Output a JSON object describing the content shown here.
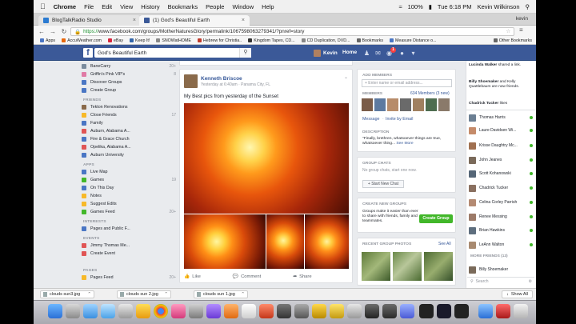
{
  "menubar": {
    "items": [
      "Chrome",
      "File",
      "Edit",
      "View",
      "History",
      "Bookmarks",
      "People",
      "Window",
      "Help"
    ],
    "battery": "100%",
    "clock": "Tue 6:18 PM",
    "user": "Kevin Wilkinson"
  },
  "tabs": [
    {
      "label": "BlogTalkRadio Studio",
      "active": false
    },
    {
      "label": "(1) God's Beautiful Earth",
      "active": true
    },
    {
      "label": "kevin",
      "active": false
    }
  ],
  "url": {
    "scheme": "https://",
    "rest": "www.facebook.com/groups/MotherNaturesGlory/permalink/1067598063279341/?pnref=story"
  },
  "bookmarks": [
    "Apps",
    "AccuWeather.com",
    "eBay",
    "Keep It!",
    "SNOWatHOME",
    "Hebrew for Christia..",
    "Kingdom Tapes, CD...",
    "CD Duplication, DVD...",
    "Bookmarks",
    "Measure Distance o..."
  ],
  "bookmarks_other": "Other Bookmarks",
  "fb": {
    "search_value": "God's Beautiful Earth",
    "user_name": "Kevin",
    "home": "Home",
    "notif_count": "1"
  },
  "leftnav": {
    "top": [
      {
        "label": "BaneCarry",
        "count": "20+",
        "color": "#7b8c9e"
      },
      {
        "label": "Griffin's Pink VIP's",
        "count": "8",
        "color": "#e07aa5"
      },
      {
        "label": "Discover Groups",
        "count": "",
        "color": "#4a76c4"
      },
      {
        "label": "Create Group",
        "count": "",
        "color": "#4a76c4"
      }
    ],
    "friends_head": "FRIENDS",
    "friends": [
      {
        "label": "Tekton Renovations",
        "count": "",
        "color": "#8a6a4a"
      },
      {
        "label": "Close Friends",
        "count": "17",
        "color": "#f7b928"
      },
      {
        "label": "Family",
        "count": "",
        "color": "#4a76c4"
      },
      {
        "label": "Auburn, Alabama A...",
        "count": "",
        "color": "#e05555"
      },
      {
        "label": "Fire & Grace Church",
        "count": "",
        "color": "#4a76c4"
      },
      {
        "label": "Opelika, Alabama A...",
        "count": "",
        "color": "#e05555"
      },
      {
        "label": "Auburn University",
        "count": "",
        "color": "#4a76c4"
      }
    ],
    "apps_head": "APPS",
    "apps": [
      {
        "label": "Live Map",
        "count": "",
        "color": "#4a76c4"
      },
      {
        "label": "Games",
        "count": "19",
        "color": "#42b72a"
      },
      {
        "label": "On This Day",
        "count": "",
        "color": "#4a76c4"
      },
      {
        "label": "Notes",
        "count": "",
        "color": "#f7b928"
      },
      {
        "label": "Suggest Edits",
        "count": "",
        "color": "#f7b928"
      },
      {
        "label": "Games Feed",
        "count": "20+",
        "color": "#42b72a"
      }
    ],
    "interests_head": "INTERESTS",
    "interests": [
      {
        "label": "Pages and Public F...",
        "count": "",
        "color": "#4a76c4"
      }
    ],
    "events_head": "EVENTS",
    "events": [
      {
        "label": "Jimmy Thomas Me...",
        "count": "",
        "color": "#e05555"
      },
      {
        "label": "Create Event",
        "count": "",
        "color": "#e05555"
      }
    ],
    "pages_head": "PAGES",
    "pages": [
      {
        "label": "Pages Feed",
        "count": "20+",
        "color": "#f7b928"
      }
    ]
  },
  "post": {
    "author": "Kenneth Briscoe",
    "meta": "Yesterday at 6:40am · Panama City, FL",
    "text": "My Best pics from yesterday of the Sunset",
    "actions": [
      "Like",
      "Comment",
      "Share"
    ]
  },
  "members_card": {
    "add_head": "ADD MEMBERS",
    "add_placeholder": "+ Enter name or email address...",
    "members_head": "MEMBERS",
    "members_count": "634 Members (3 new)",
    "message_link": "Message",
    "invite_link": "Invite by Email",
    "desc_head": "DESCRIPTION",
    "desc_text": "\"Finally, brethren, whatsoever things are true, whatsoever thing...",
    "see_more": "See More"
  },
  "chats_card": {
    "head": "GROUP CHATS",
    "text": "No group chats, start one now.",
    "button": "+ Start New Chat"
  },
  "create_card": {
    "head": "CREATE NEW GROUPS",
    "text": "Groups make it easier than ever to share with friends, family and teammates.",
    "button": "Create Group"
  },
  "photos_card": {
    "head": "RECENT GROUP PHOTOS",
    "see_all": "See All"
  },
  "ticker": [
    {
      "name": "Lucinda Walker",
      "text": "shared a link."
    },
    {
      "name": "Billy Shoemaker",
      "text": "and Kelly Quattlebaum are now friends."
    },
    {
      "name": "Chadrick Tucker",
      "text": "likes"
    }
  ],
  "chat_list": [
    {
      "name": "Thomas Harris",
      "online": true,
      "color": "#6b7f93"
    },
    {
      "name": "Laure Davidsen Wi...",
      "online": true,
      "color": "#c58b6a"
    },
    {
      "name": "Krisse Daughtry Mc...",
      "online": true,
      "color": "#a07050"
    },
    {
      "name": "John Jeanes",
      "online": true,
      "color": "#7a6a5a"
    },
    {
      "name": "Scott Kohanowski",
      "online": true,
      "color": "#556677"
    },
    {
      "name": "Chadrick Tucker",
      "online": true,
      "color": "#8a7060"
    },
    {
      "name": "Celina Corley Parrish",
      "online": true,
      "color": "#b48a72"
    },
    {
      "name": "Renee Messing",
      "online": true,
      "color": "#9c7a68"
    },
    {
      "name": "Brian Hawkins",
      "online": true,
      "color": "#5e6e7e"
    },
    {
      "name": "LeAnn Walton",
      "online": true,
      "color": "#a88a70"
    }
  ],
  "more_friends": "MORE FRIENDS (13)",
  "more_friend": {
    "name": "Billy Shoemaker",
    "color": "#7a6a5a"
  },
  "chat_search_placeholder": "Search",
  "downloads": [
    {
      "name": "clouds sun3.jpg"
    },
    {
      "name": "clouds sun 2.jpg"
    },
    {
      "name": "clouds sun 1.jpg"
    }
  ],
  "downloads_show_all": "Show All",
  "colors": {
    "fb_blue": "#3b5998",
    "link": "#365899",
    "green": "#42b72a"
  }
}
